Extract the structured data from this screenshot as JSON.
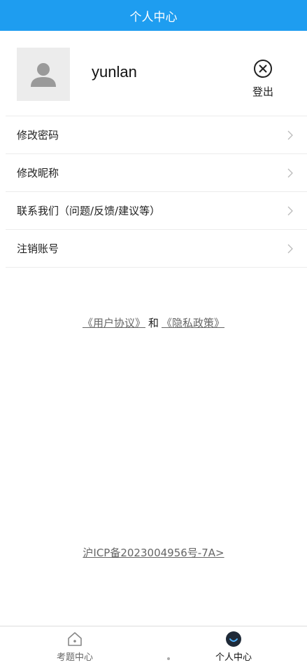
{
  "header": {
    "title": "个人中心"
  },
  "profile": {
    "username": "yunlan",
    "logout_label": "登出"
  },
  "menu": {
    "items": [
      {
        "label": "修改密码"
      },
      {
        "label": "修改昵称"
      },
      {
        "label": "联系我们（问题/反馈/建议等）"
      },
      {
        "label": "注销账号"
      }
    ]
  },
  "links": {
    "user_agreement": "《用户协议》",
    "and": "和",
    "privacy_policy": "《隐私政策》"
  },
  "icp": {
    "text": "沪ICP备2023004956号-7A>"
  },
  "tabbar": {
    "tabs": [
      {
        "label": "考题中心",
        "icon": "home-icon",
        "active": false
      },
      {
        "label": "个人中心",
        "icon": "person-circle-icon",
        "active": true
      }
    ]
  },
  "colors": {
    "header_bg": "#1e9df0",
    "active_tab_icon": "#1f2a38",
    "divider": "#ececec"
  }
}
